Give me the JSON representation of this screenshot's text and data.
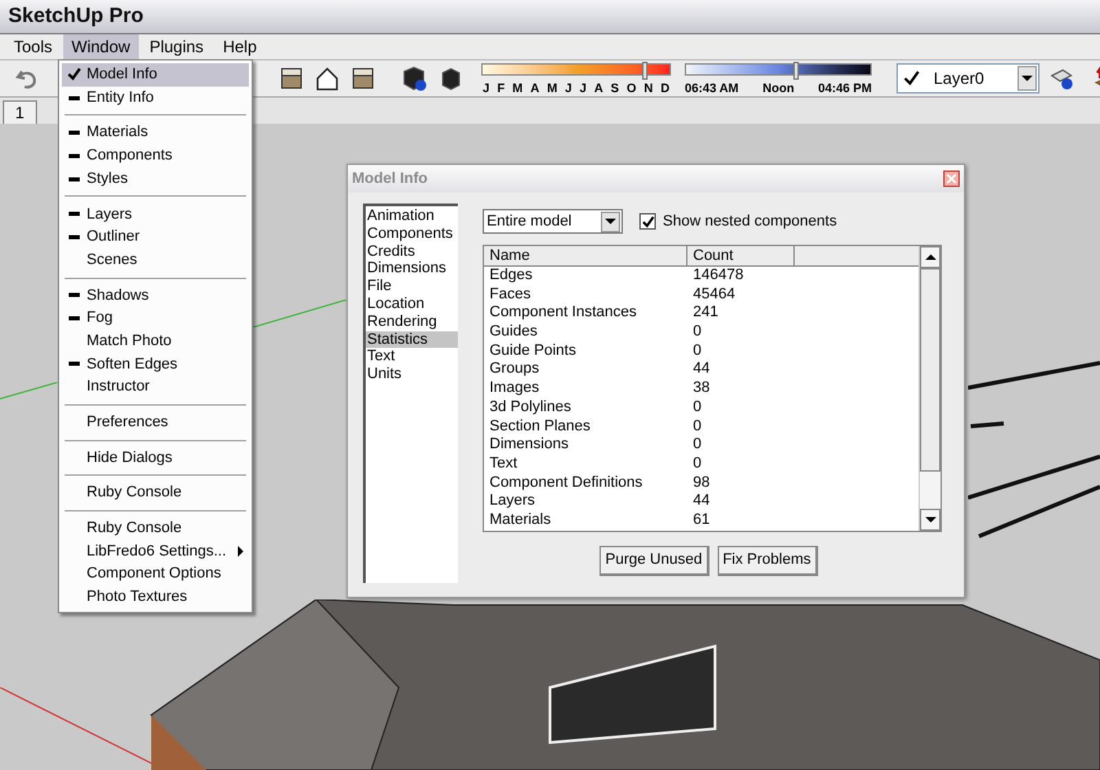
{
  "app_title": "SketchUp Pro",
  "menu_bar": [
    {
      "label": "Tools",
      "selected": false
    },
    {
      "label": "Window",
      "selected": true
    },
    {
      "label": "Plugins",
      "selected": false
    },
    {
      "label": "Help",
      "selected": false
    }
  ],
  "window_menu": [
    [
      {
        "label": "Model Info",
        "kind": "check",
        "selected": true,
        "submenu": false
      },
      {
        "label": "Entity Info",
        "kind": "dash",
        "selected": false,
        "submenu": false
      }
    ],
    [
      {
        "label": "Materials",
        "kind": "dash",
        "selected": false,
        "submenu": false
      },
      {
        "label": "Components",
        "kind": "dash",
        "selected": false,
        "submenu": false
      },
      {
        "label": "Styles",
        "kind": "dash",
        "selected": false,
        "submenu": false
      }
    ],
    [
      {
        "label": "Layers",
        "kind": "dash",
        "selected": false,
        "submenu": false
      },
      {
        "label": "Outliner",
        "kind": "dash",
        "selected": false,
        "submenu": false
      },
      {
        "label": "Scenes",
        "kind": "plain",
        "selected": false,
        "submenu": false
      }
    ],
    [
      {
        "label": "Shadows",
        "kind": "dash",
        "selected": false,
        "submenu": false
      },
      {
        "label": "Fog",
        "kind": "dash",
        "selected": false,
        "submenu": false
      },
      {
        "label": "Match Photo",
        "kind": "plain",
        "selected": false,
        "submenu": false
      },
      {
        "label": "Soften Edges",
        "kind": "dash",
        "selected": false,
        "submenu": false
      },
      {
        "label": "Instructor",
        "kind": "plain",
        "selected": false,
        "submenu": false
      }
    ],
    [
      {
        "label": "Preferences",
        "kind": "plain",
        "selected": false,
        "submenu": false
      }
    ],
    [
      {
        "label": "Hide Dialogs",
        "kind": "plain",
        "selected": false,
        "submenu": false
      }
    ],
    [
      {
        "label": "Ruby Console",
        "kind": "plain",
        "selected": false,
        "submenu": false
      }
    ],
    [
      {
        "label": "Ruby Console",
        "kind": "plain",
        "selected": false,
        "submenu": false
      },
      {
        "label": "LibFredo6 Settings...",
        "kind": "plain",
        "selected": false,
        "submenu": true
      },
      {
        "label": "Component Options",
        "kind": "plain",
        "selected": false,
        "submenu": false
      },
      {
        "label": "Photo Textures",
        "kind": "plain",
        "selected": false,
        "submenu": false
      }
    ]
  ],
  "toolbar": {
    "month_slider": {
      "labels": [
        "J",
        "F",
        "M",
        "A",
        "M",
        "J",
        "J",
        "A",
        "S",
        "O",
        "N",
        "D"
      ],
      "level": 0.87
    },
    "time_slider": {
      "start": "06:43 AM",
      "middle": "Noon",
      "end": "04:46 PM",
      "level": 0.6
    },
    "layer_select": {
      "checked": true,
      "value": "Layer0"
    }
  },
  "scene_tab": "1",
  "model_info": {
    "title": "Model Info",
    "sections": [
      {
        "label": "Animation",
        "selected": false
      },
      {
        "label": "Components",
        "selected": false
      },
      {
        "label": "Credits",
        "selected": false
      },
      {
        "label": "Dimensions",
        "selected": false
      },
      {
        "label": "File",
        "selected": false
      },
      {
        "label": "Location",
        "selected": false
      },
      {
        "label": "Rendering",
        "selected": false
      },
      {
        "label": "Statistics",
        "selected": true
      },
      {
        "label": "Text",
        "selected": false
      },
      {
        "label": "Units",
        "selected": false
      }
    ],
    "scope": "Entire model",
    "nested": {
      "label": "Show nested components",
      "checked": true
    },
    "columns": [
      "Name",
      "Count"
    ],
    "rows": [
      {
        "name": "Edges",
        "count": "146478"
      },
      {
        "name": "Faces",
        "count": "45464"
      },
      {
        "name": "Component Instances",
        "count": "241"
      },
      {
        "name": "Guides",
        "count": "0"
      },
      {
        "name": "Guide Points",
        "count": "0"
      },
      {
        "name": "Groups",
        "count": "44"
      },
      {
        "name": "Images",
        "count": "38"
      },
      {
        "name": "3d Polylines",
        "count": "0"
      },
      {
        "name": "Section Planes",
        "count": "0"
      },
      {
        "name": "Dimensions",
        "count": "0"
      },
      {
        "name": "Text",
        "count": "0"
      },
      {
        "name": "Component Definitions",
        "count": "98"
      },
      {
        "name": "Layers",
        "count": "44"
      },
      {
        "name": "Materials",
        "count": "61"
      }
    ],
    "buttons": [
      "Purge Unused",
      "Fix Problems"
    ]
  }
}
